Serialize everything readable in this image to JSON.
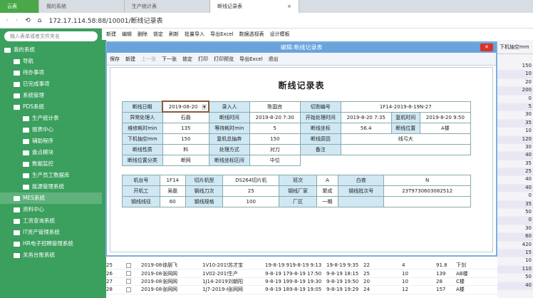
{
  "browser": {
    "tabs": [
      "云表",
      "我的系统",
      "生产统计表",
      "断线记录表"
    ],
    "url": "172.17.114.58:88/10001/断线记录表"
  },
  "sidebar": {
    "search_placeholder": "输入表单或者文件夹名",
    "items": [
      {
        "label": "我的系统",
        "level": 0,
        "icon": "home-icon"
      },
      {
        "label": "导航",
        "level": 1,
        "icon": "clipboard-icon"
      },
      {
        "label": "待办事项",
        "level": 1,
        "icon": "list-icon"
      },
      {
        "label": "已完成事项",
        "level": 1,
        "icon": "list-icon"
      },
      {
        "label": "系统管理",
        "level": 1,
        "icon": "folder-icon"
      },
      {
        "label": "PDS系统",
        "level": 1,
        "icon": "folder-icon"
      },
      {
        "label": "生产统计表",
        "level": 2,
        "icon": "folder-icon"
      },
      {
        "label": "报表中心",
        "level": 2,
        "icon": "folder-icon"
      },
      {
        "label": "辅助程序",
        "level": 2,
        "icon": "folder-icon"
      },
      {
        "label": "盘点模块",
        "level": 2,
        "icon": "folder-icon"
      },
      {
        "label": "数据监控",
        "level": 2,
        "icon": "folder-icon"
      },
      {
        "label": "生产员工数据库",
        "level": 2,
        "icon": "user-icon"
      },
      {
        "label": "能源管理系统",
        "level": 2,
        "icon": "folder-icon"
      },
      {
        "label": "MES系统",
        "level": 1,
        "icon": "folder-icon",
        "selected": true
      },
      {
        "label": "资料中心",
        "level": 1,
        "icon": "folder-icon"
      },
      {
        "label": "工资查询系统",
        "level": 1,
        "icon": "folder-icon"
      },
      {
        "label": "IT资产管理系统",
        "level": 1,
        "icon": "folder-icon"
      },
      {
        "label": "HR电子招聘管理系统",
        "level": 1,
        "icon": "folder-icon"
      },
      {
        "label": "关务台账系统",
        "level": 1,
        "icon": "folder-icon"
      }
    ]
  },
  "toolbar": [
    "新建",
    "编辑",
    "删除",
    "锁定",
    "刷新",
    "批量导入",
    "导出Excel",
    "数据透视表",
    "设计模板"
  ],
  "grid": {
    "right_header": "下机抽空mm",
    "right_values": [
      "150",
      "10",
      "20",
      "200",
      "0",
      "5",
      "30",
      "35",
      "10",
      "120",
      "30",
      "40",
      "35",
      "25",
      "40",
      "40",
      "0",
      "35",
      "50",
      "0",
      "30",
      "60",
      "420",
      "15",
      "10",
      "110",
      "50",
      "40"
    ],
    "rows": [
      [
        "25",
        "2019-08-19",
        "徐朋飞",
        "1V10-2019-8",
        "苏才宝",
        "19-8-19 9:09",
        "19-8-19 9:13",
        "19-8-19 9:35",
        "22",
        "4",
        "91.8",
        "下剑"
      ],
      [
        "26",
        "2019-08-19",
        "张网网",
        "1V02-2019-8",
        "生产",
        "9-8-19 17:40",
        "9-8-19 17:50",
        "9-8-19 18:15",
        "25",
        "10",
        "139",
        "AB楼"
      ],
      [
        "27",
        "2019-08-19",
        "张网网",
        "1J14-2019-8",
        "刘朝阳",
        "9-8-19 19:20",
        "9-8-19 19:30",
        "9-8-19 19:50",
        "20",
        "10",
        "28",
        "C楼"
      ],
      [
        "28",
        "2019-08-19",
        "张网网",
        "1J7-2019-8-1",
        "张网网",
        "9-8-19 18:53",
        "9-8-19 19:05",
        "9-8-19 19:29",
        "24",
        "12",
        "157",
        "A楼"
      ]
    ]
  },
  "modal": {
    "title": "编辑:断线记录表",
    "toolbar": [
      "保存",
      "新建",
      "上一张",
      "下一张",
      "锁定",
      "打印",
      "打印预览",
      "导出Excel",
      "退出"
    ],
    "form_title": "断线记录表",
    "table1": [
      [
        [
          "断线日期",
          "l"
        ],
        [
          "2019-08-20",
          "sel"
        ],
        [
          "录入人",
          "l"
        ],
        [
          "陈国良",
          ""
        ],
        [
          "切割编号",
          "l"
        ],
        [
          "1F14-2019-8-19N-27",
          "",
          3
        ]
      ],
      [
        [
          "异常处理人",
          "l"
        ],
        [
          "石磊",
          ""
        ],
        [
          "断线时间",
          "l"
        ],
        [
          "2019-8-20 7:30",
          ""
        ],
        [
          "开始处理时间",
          "l"
        ],
        [
          "2019-8-20 7:35",
          ""
        ],
        [
          "复机时间",
          "l"
        ],
        [
          "2019-8-20 9:50",
          ""
        ]
      ],
      [
        [
          "维修耗时min",
          "l"
        ],
        [
          "135",
          ""
        ],
        [
          "等待耗时min",
          "l"
        ],
        [
          "5",
          ""
        ],
        [
          "断线坐标",
          "l"
        ],
        [
          "56.4",
          ""
        ],
        [
          "断线位置",
          "l"
        ],
        [
          "A楼",
          ""
        ]
      ],
      [
        [
          "下机抽空mm",
          "l"
        ],
        [
          "150",
          ""
        ],
        [
          "复机总抽弃",
          "l"
        ],
        [
          "150",
          ""
        ],
        [
          "断线原因",
          "l"
        ],
        [
          "线弓大",
          "",
          3
        ]
      ],
      [
        [
          "断线性质",
          "l"
        ],
        [
          "料",
          ""
        ],
        [
          "处理方式",
          "l"
        ],
        [
          "对刀",
          ""
        ],
        [
          "备注",
          "l"
        ],
        [
          "",
          "",
          3
        ]
      ],
      [
        [
          "断线位置分类",
          "l"
        ],
        [
          "断网",
          ""
        ],
        [
          "断线坐标区间",
          "l"
        ],
        [
          "中位",
          ""
        ]
      ]
    ],
    "table2": [
      [
        [
          "机台号",
          "l"
        ],
        [
          "1F14",
          ""
        ],
        [
          "切片机型",
          "l"
        ],
        [
          "DS264切片机",
          ""
        ],
        [
          "班次",
          "l"
        ],
        [
          "A",
          ""
        ],
        [
          "白夜",
          "l"
        ],
        [
          "N",
          ""
        ]
      ],
      [
        [
          "开机工",
          "l"
        ],
        [
          "吴磊",
          ""
        ],
        [
          "钢线刀次",
          "l"
        ],
        [
          "25",
          ""
        ],
        [
          "钢线厂家",
          "l"
        ],
        [
          "聚成",
          ""
        ],
        [
          "钢线批次号",
          "l"
        ],
        [
          "23T9730603082512",
          ""
        ]
      ],
      [
        [
          "钢线线径",
          "l"
        ],
        [
          "60",
          ""
        ],
        [
          "钢线规格",
          "l"
        ],
        [
          "100",
          ""
        ],
        [
          "厂区",
          "l"
        ],
        [
          "一期",
          ""
        ],
        [
          "",
          "l"
        ],
        [
          "",
          ""
        ]
      ]
    ]
  }
}
